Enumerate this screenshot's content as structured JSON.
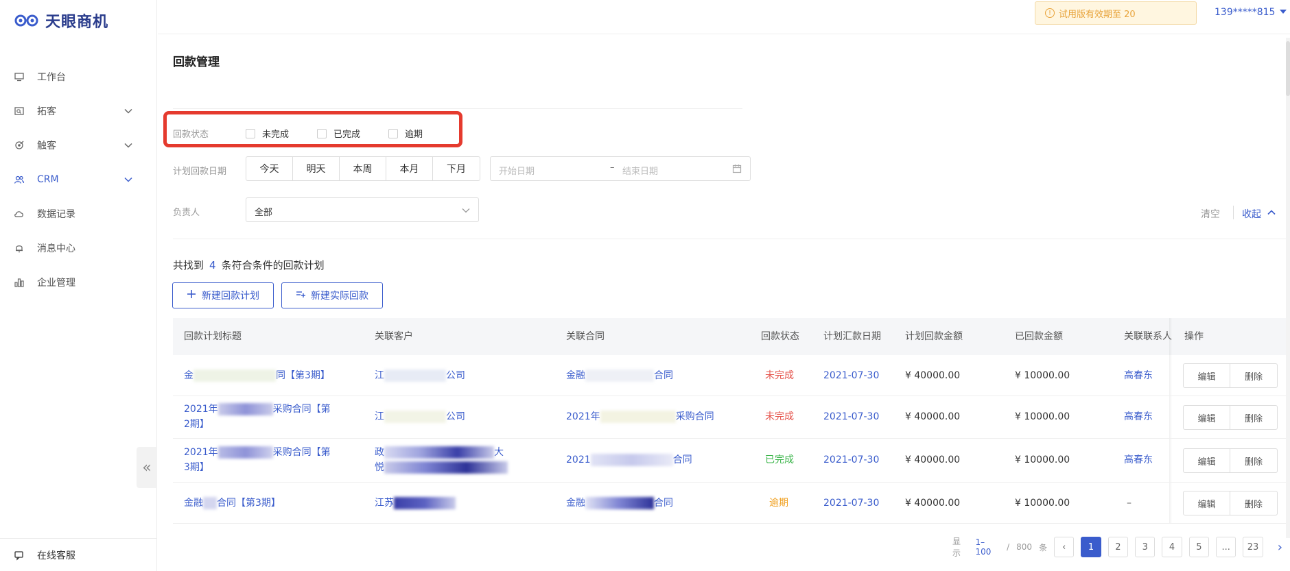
{
  "app": {
    "brand": "天眼商机"
  },
  "sidebar": {
    "items": [
      {
        "label": "工作台",
        "icon": "monitor-icon"
      },
      {
        "label": "拓客",
        "icon": "search-card-icon"
      },
      {
        "label": "触客",
        "icon": "target-icon"
      },
      {
        "label": "CRM",
        "icon": "users-icon"
      },
      {
        "label": "数据记录",
        "icon": "cloud-icon"
      },
      {
        "label": "消息中心",
        "icon": "bell-icon"
      },
      {
        "label": "企业管理",
        "icon": "bar-chart-icon"
      }
    ],
    "service_label": "在线客服"
  },
  "topbar": {
    "trial_text": "试用版有效期至 20",
    "user": "139*****815"
  },
  "page": {
    "title": "回款管理"
  },
  "filters": {
    "status_label": "回款状态",
    "status_options": [
      "未完成",
      "已完成",
      "逾期"
    ],
    "date_label": "计划回款日期",
    "date_buttons": [
      "今天",
      "明天",
      "本周",
      "本月",
      "下月"
    ],
    "date_start_placeholder": "开始日期",
    "date_end_placeholder": "结束日期",
    "owner_label": "负责人",
    "owner_value": "全部",
    "clear_label": "清空",
    "fold_label": "收起"
  },
  "results": {
    "prefix": "共找到",
    "count": "4",
    "suffix": "条符合条件的回款计划"
  },
  "actions": {
    "new_plan": "新建回款计划",
    "new_actual": "新建实际回款"
  },
  "table": {
    "headers": [
      "回款计划标题",
      "关联客户",
      "关联合同",
      "回款状态",
      "计划汇款日期",
      "计划回款金额",
      "已回款金额",
      "关联联系人",
      "操作"
    ],
    "rows": [
      {
        "title_a": "金",
        "title_b": "同【第3期】",
        "customer_a": "江",
        "customer_b": "公司",
        "contract_a": "金融",
        "contract_b": "合同",
        "status": "未完成",
        "status_color": "#e5534b",
        "date": "2021-07-30",
        "plan_amount": "¥ 40000.00",
        "paid_amount": "¥ 10000.00",
        "contact": "高春东"
      },
      {
        "title_a": "2021年",
        "title_b": "采购合同【第",
        "title_c": "2期】",
        "customer_a": "江",
        "customer_b": "公司",
        "contract_a": "2021年",
        "contract_b": "采购合同",
        "status": "未完成",
        "status_color": "#e5534b",
        "date": "2021-07-30",
        "plan_amount": "¥ 40000.00",
        "paid_amount": "¥ 10000.00",
        "contact": "高春东"
      },
      {
        "title_a": "2021年",
        "title_b": "采购合同【第",
        "title_c": "3期】",
        "customer_a": "政",
        "customer_b": "大",
        "customer_c": "悦",
        "contract_a": "2021",
        "contract_b": "合同",
        "status": "已完成",
        "status_color": "#3bb54a",
        "date": "2021-07-30",
        "plan_amount": "¥ 40000.00",
        "paid_amount": "¥ 10000.00",
        "contact": "高春东"
      },
      {
        "title_a": "金融",
        "title_b": "合同【第3期】",
        "customer_a": "江苏",
        "customer_b": "",
        "contract_a": "金融",
        "contract_b": "合同",
        "status": "逾期",
        "status_color": "#f0a020",
        "date": "2021-07-30",
        "plan_amount": "¥ 40000.00",
        "paid_amount": "¥ 10000.00",
        "contact": "–"
      }
    ],
    "op_edit": "编辑",
    "op_delete": "删除"
  },
  "pager": {
    "show_label": "显示",
    "range": "1–100",
    "sep": "/",
    "total": "800",
    "unit": "条",
    "pages": [
      "1",
      "2",
      "3",
      "4",
      "5",
      "...",
      "23"
    ],
    "prev": "‹",
    "next": "›"
  },
  "colors": {
    "accent": "#3a5ccc",
    "highlight": "#e53a2e"
  }
}
